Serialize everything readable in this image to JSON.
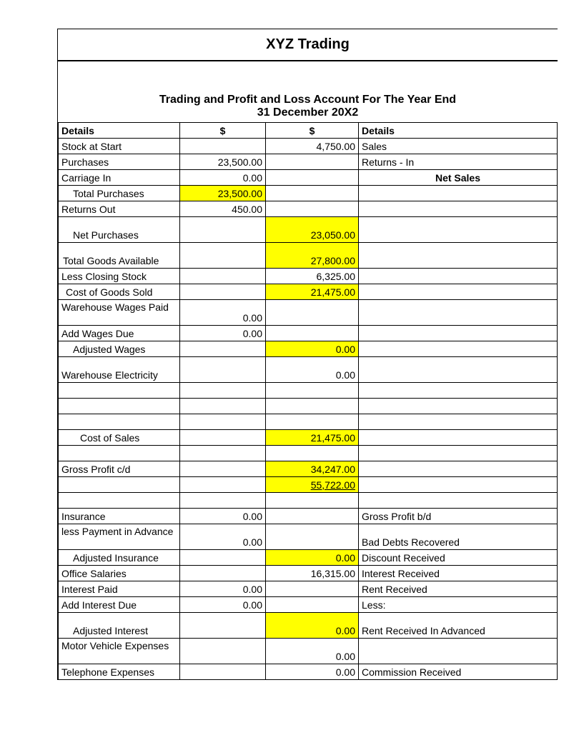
{
  "title": "XYZ Trading",
  "subtitle_line1": "Trading and Profit and Loss Account For The Year End",
  "subtitle_line2": "31 December 20X2",
  "headers": {
    "details": "Details",
    "dollar": "$"
  },
  "rows": {
    "r1": {
      "a": "Stock at Start",
      "b": "",
      "c": "4,750.00",
      "d": "Sales"
    },
    "r2": {
      "a": "Purchases",
      "b": "23,500.00",
      "c": "",
      "d": "Returns - In"
    },
    "r3": {
      "a": "Carriage In",
      "b": "0.00",
      "c": "",
      "d": "Net Sales"
    },
    "r4": {
      "a": "Total Purchases",
      "b": "23,500.00",
      "c": "",
      "d": ""
    },
    "r5": {
      "a": "Returns Out",
      "b": "450.00",
      "c": "",
      "d": ""
    },
    "r6": {
      "a": "Net Purchases",
      "b": "",
      "c": "23,050.00",
      "d": ""
    },
    "r7": {
      "a": "Total Goods Available",
      "b": "",
      "c": "27,800.00",
      "d": ""
    },
    "r8": {
      "a": "Less Closing Stock",
      "b": "",
      "c": "6,325.00",
      "d": ""
    },
    "r9": {
      "a": "Cost of Goods Sold",
      "b": "",
      "c": "21,475.00",
      "d": ""
    },
    "r10": {
      "a": "Warehouse Wages Paid",
      "b": "0.00",
      "c": "",
      "d": ""
    },
    "r11": {
      "a": "Add Wages Due",
      "b": "0.00",
      "c": "",
      "d": ""
    },
    "r12": {
      "a": "Adjusted Wages",
      "b": "",
      "c": "0.00",
      "d": ""
    },
    "r13": {
      "a": "Warehouse Electricity",
      "b": "",
      "c": "0.00",
      "d": ""
    },
    "r14": {
      "a": "",
      "b": "",
      "c": "",
      "d": ""
    },
    "r15": {
      "a": "",
      "b": "",
      "c": "",
      "d": ""
    },
    "r16": {
      "a": "",
      "b": "",
      "c": "",
      "d": ""
    },
    "r17": {
      "a": "Cost of Sales",
      "b": "",
      "c": "21,475.00",
      "d": ""
    },
    "r18": {
      "a": "",
      "b": "",
      "c": "",
      "d": ""
    },
    "r19": {
      "a": "Gross Profit c/d",
      "b": "",
      "c": "34,247.00",
      "d": ""
    },
    "r20": {
      "a": "",
      "b": "",
      "c": "55,722.00",
      "d": ""
    },
    "r21": {
      "a": "",
      "b": "",
      "c": "",
      "d": ""
    },
    "r22": {
      "a": "Insurance",
      "b": "0.00",
      "c": "",
      "d": "Gross Profit b/d"
    },
    "r23": {
      "a": "less Payment in Advance",
      "b": "0.00",
      "c": "",
      "d": "Bad Debts Recovered"
    },
    "r24": {
      "a": "Adjusted Insurance",
      "b": "",
      "c": "0.00",
      "d": "Discount Received"
    },
    "r25": {
      "a": "Office Salaries",
      "b": "",
      "c": "16,315.00",
      "d": "Interest Received"
    },
    "r26": {
      "a": "Interest Paid",
      "b": "0.00",
      "c": "",
      "d": "Rent Received"
    },
    "r27": {
      "a": "Add Interest Due",
      "b": "0.00",
      "c": "",
      "d": "Less:"
    },
    "r28": {
      "a": "Adjusted Interest",
      "b": "",
      "c": "0.00",
      "d": "Rent Received In Advanced"
    },
    "r29": {
      "a": "Motor Vehicle Expenses",
      "b": "",
      "c": "0.00",
      "d": ""
    },
    "r30": {
      "a": "Telephone Expenses",
      "b": "",
      "c": "0.00",
      "d": "Commission Received"
    }
  }
}
